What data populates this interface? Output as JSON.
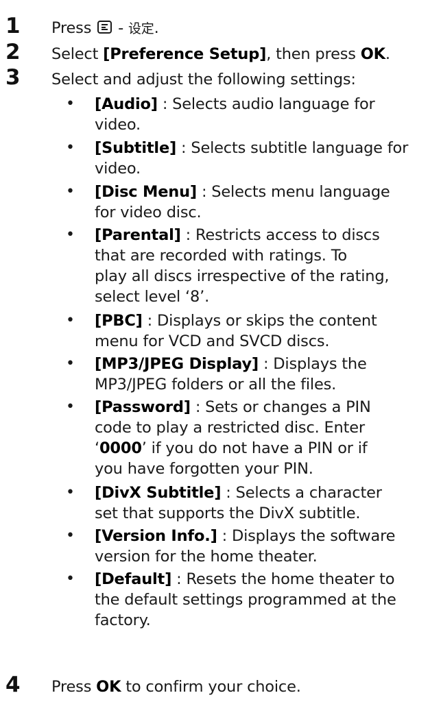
{
  "steps": [
    {
      "num": "1",
      "pre": "Press",
      "icon": "menu-icon",
      "mid": " - ",
      "cjk": "设定",
      "post": "."
    },
    {
      "num": "2",
      "pre": "Select ",
      "bold1": "[Preference Setup]",
      "mid": ", then press ",
      "bold2": "OK",
      "post": "."
    },
    {
      "num": "3",
      "text": "Select and adjust the following settings:"
    },
    {
      "num": "4",
      "pre": "Press ",
      "bold": "OK",
      "post": " to confirm your choice."
    }
  ],
  "settings": [
    {
      "label": "[Audio]",
      "line1": " : Selects audio language for",
      "rest": [
        "video."
      ]
    },
    {
      "label": "[Subtitle]",
      "line1": " : Selects subtitle language for",
      "rest": [
        "video."
      ]
    },
    {
      "label": "[Disc Menu]",
      "line1": " : Selects menu language",
      "rest": [
        "for video disc."
      ]
    },
    {
      "label": "[Parental]",
      "line1": " : Restricts access to discs",
      "rest": [
        "that are recorded with ratings. To",
        "play all discs irrespective of the rating,",
        "select level ‘8’."
      ]
    },
    {
      "label": "[PBC]",
      "line1": " : Displays or skips the content",
      "rest": [
        "menu for VCD and SVCD discs."
      ]
    },
    {
      "label": "[MP3/JPEG Display]",
      "line1": " : Displays the",
      "rest": [
        "MP3/JPEG folders or all the files."
      ]
    },
    {
      "label": "[Password]",
      "line1": " : Sets or changes a PIN",
      "rest": [
        "code to play a restricted disc. Enter"
      ],
      "special_pre": "‘",
      "special_bold": "0000",
      "special_post": "’ if you do not have a PIN or if",
      "rest2": [
        "you have forgotten your PIN."
      ]
    },
    {
      "label": "[DivX Subtitle]",
      "line1": " : Selects a character",
      "rest": [
        "set that supports the DivX subtitle."
      ]
    },
    {
      "label": "[Version Info.]",
      "line1": " : Displays the software",
      "rest": [
        "version for the home theater."
      ]
    },
    {
      "label": "[Default]",
      "line1": " : Resets the home theater to",
      "rest": [
        "the default settings programmed at the",
        "factory."
      ]
    }
  ],
  "bullet_char": "•"
}
